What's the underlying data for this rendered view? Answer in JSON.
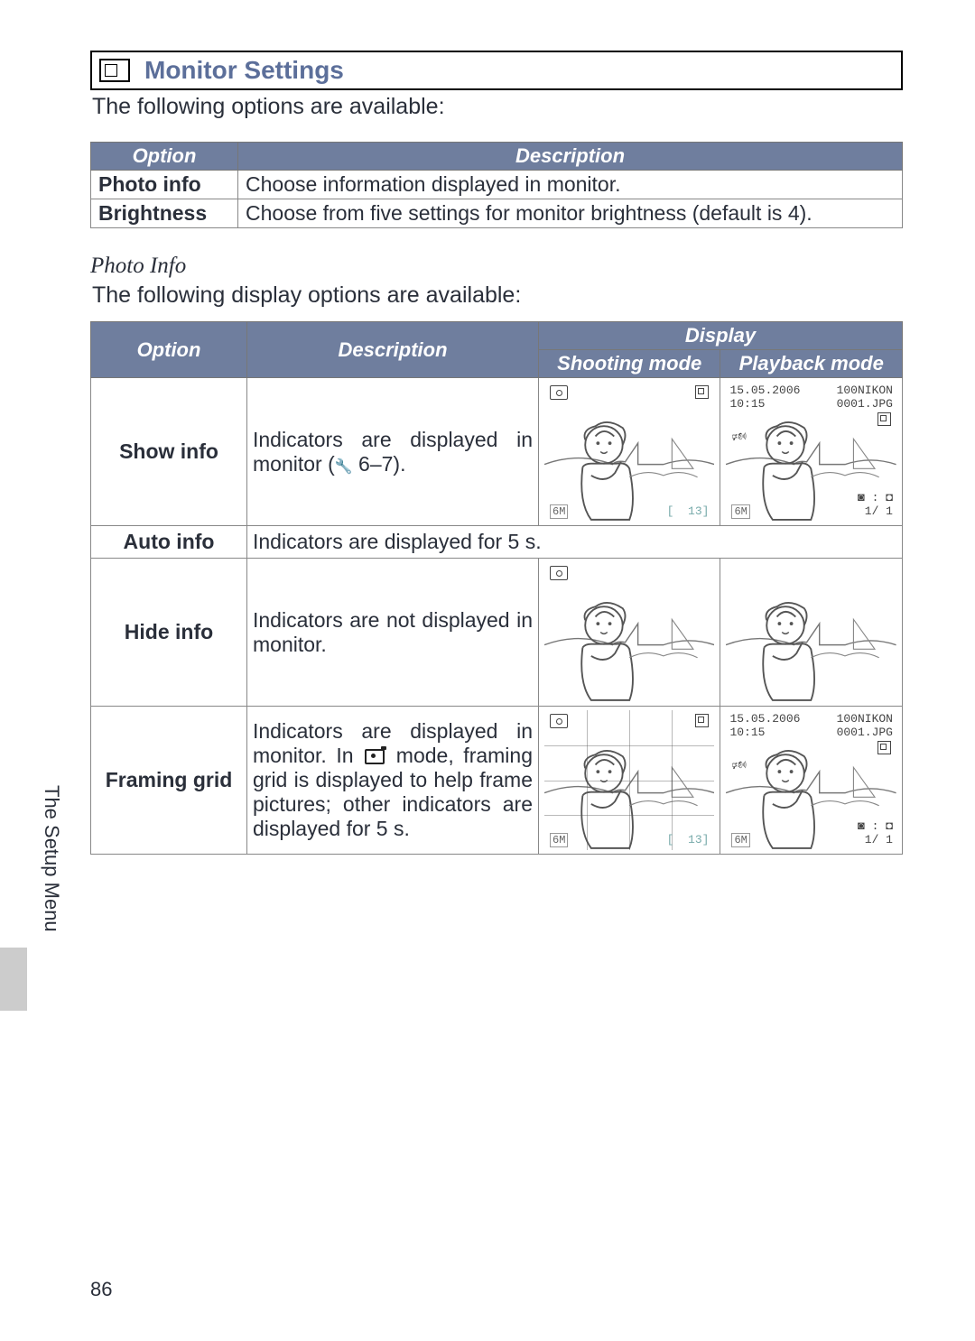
{
  "header": {
    "title": "Monitor Settings"
  },
  "intro": "The following options are available:",
  "table1": {
    "headers": [
      "Option",
      "Description"
    ],
    "rows": [
      {
        "opt": "Photo info",
        "desc": "Choose information displayed in monitor."
      },
      {
        "opt": "Brightness",
        "desc": "Choose from five settings for monitor brightness (default is 4)."
      }
    ]
  },
  "photo_info": {
    "title": "Photo Info",
    "intro": "The following display options are available:"
  },
  "table2": {
    "headers": {
      "option": "Option",
      "description": "Description",
      "display": "Display",
      "shooting": "Shooting mode",
      "playback": "Playback mode"
    },
    "rows": [
      {
        "opt": "Show info",
        "desc_pre": "Indicators are displayed in monitor (",
        "desc_post": " 6–7)."
      },
      {
        "opt": "Auto info",
        "desc": "Indicators are displayed for 5 s."
      },
      {
        "opt": "Hide info",
        "desc": "Indicators are not displayed in monitor."
      },
      {
        "opt": "Framing grid",
        "desc_pre": "Indicators are displayed in monitor. In ",
        "desc_post": " mode, framing grid is displayed to help frame pictures; other indicators are displayed for 5 s."
      }
    ]
  },
  "overlay": {
    "date": "15.05.2006",
    "time": "10:15",
    "folder": "100NIKON",
    "file": "0001.JPG",
    "res": "6M",
    "count": "13",
    "frac": "1/   1"
  },
  "side_caption": "The Setup Menu",
  "page_number": "86"
}
